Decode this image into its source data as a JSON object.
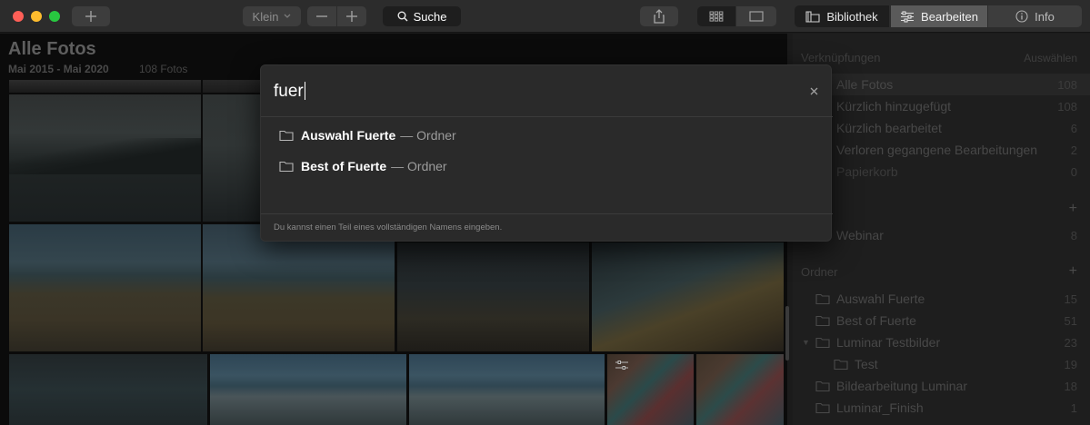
{
  "toolbar": {
    "size_label": "Klein",
    "search_label": "Suche",
    "tabs": {
      "library": "Bibliothek",
      "edit": "Bearbeiten",
      "info": "Info"
    }
  },
  "gallery": {
    "title": "Alle Fotos",
    "date_range": "Mai 2015 - Mai 2020",
    "count": "108 Fotos"
  },
  "sidebar": {
    "shortcuts_header": "Verknüpfungen",
    "shortcuts_action": "Auswählen",
    "shortcuts": [
      {
        "label": "Alle Fotos",
        "count": "108"
      },
      {
        "label": "Kürzlich hinzugefügt",
        "count": "108"
      },
      {
        "label": "Kürzlich bearbeitet",
        "count": "6"
      },
      {
        "label": "Verloren gegangene Bearbeitungen",
        "count": "2"
      },
      {
        "label": "Papierkorb",
        "count": "0"
      }
    ],
    "albums": [
      {
        "label": "Webinar",
        "count": "8"
      }
    ],
    "folders_header": "Ordner",
    "folders": [
      {
        "label": "Auswahl Fuerte",
        "count": "15"
      },
      {
        "label": "Best of Fuerte",
        "count": "51"
      },
      {
        "label": "Luminar Testbilder",
        "count": "23"
      },
      {
        "label": "Test",
        "count": "19"
      },
      {
        "label": "Bildearbeitung Luminar",
        "count": "18"
      },
      {
        "label": "Luminar_Finish",
        "count": "1"
      }
    ]
  },
  "search": {
    "query": "fuer",
    "results": [
      {
        "name": "Auswahl Fuerte",
        "kind": "— Ordner"
      },
      {
        "name": "Best of Fuerte",
        "kind": "— Ordner"
      }
    ],
    "hint": "Du kannst einen Teil eines vollständigen Namens eingeben."
  },
  "colors": {
    "toolbar_bg": "#2c2c2c",
    "popover_bg": "#2a2a2a",
    "sidebar_bg": "#1e1e1e",
    "active_tab": "#5a5a5a"
  }
}
